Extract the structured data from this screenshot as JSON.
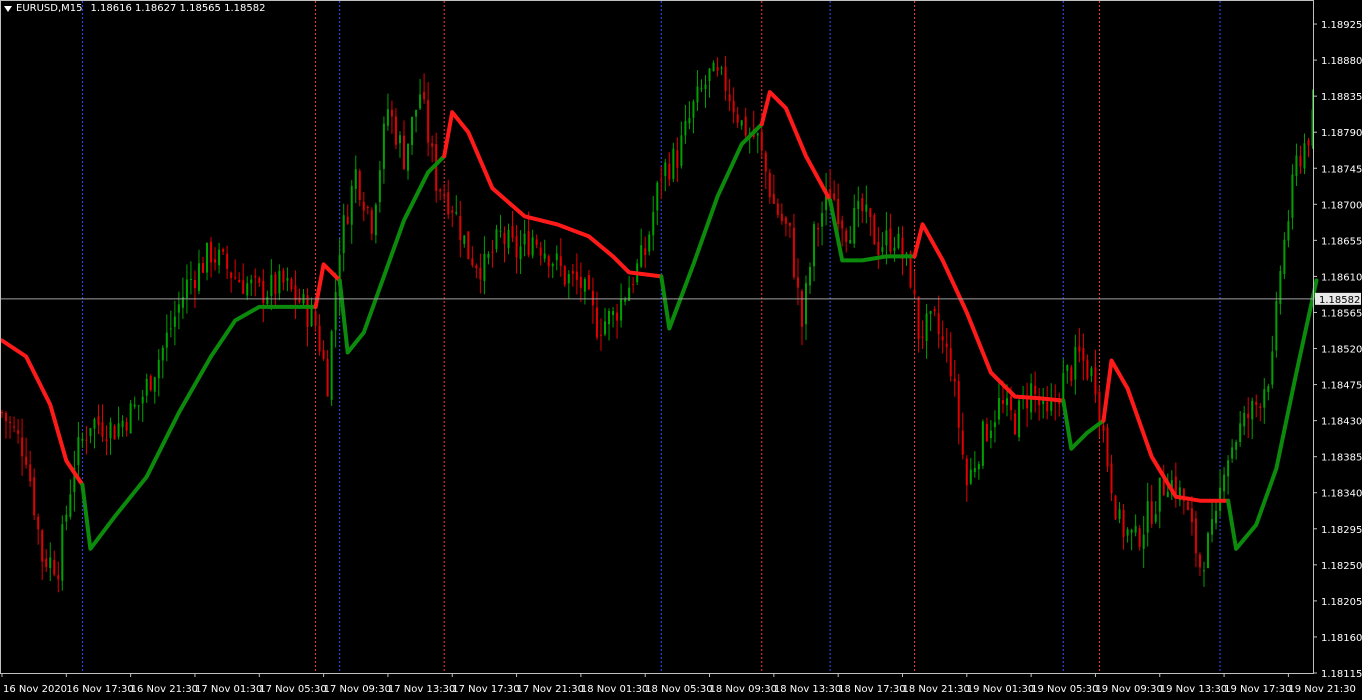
{
  "header": {
    "symbol": "EURUSD,M15",
    "ohlc": "1.18616 1.18627 1.18565 1.18582"
  },
  "colors": {
    "background": "#000000",
    "frame": "#c0c0c0",
    "candle_up": "#00a000",
    "candle_down": "#e00000",
    "line_up": "#0c8a0c",
    "line_down": "#ff1a1a",
    "separator_red": "#ff3030",
    "separator_blue": "#3050ff",
    "current_price_line": "#a0a0a0"
  },
  "chart_data": {
    "type": "candlestick",
    "y_ticks": [
      "1.18925",
      "1.18880",
      "1.18835",
      "1.18790",
      "1.18745",
      "1.18700",
      "1.18655",
      "1.18610",
      "1.18565",
      "1.18520",
      "1.18475",
      "1.18430",
      "1.18385",
      "1.18340",
      "1.18295",
      "1.18250",
      "1.18205",
      "1.18160",
      "1.18115"
    ],
    "ylim": [
      1.18115,
      1.18955
    ],
    "current_price": "1.18582",
    "x_labels": [
      "16 Nov 2020",
      "16 Nov 17:30",
      "16 Nov 21:30",
      "17 Nov 01:30",
      "17 Nov 05:30",
      "17 Nov 09:30",
      "17 Nov 13:30",
      "17 Nov 17:30",
      "17 Nov 21:30",
      "18 Nov 01:30",
      "18 Nov 05:30",
      "18 Nov 09:30",
      "18 Nov 13:30",
      "18 Nov 17:30",
      "18 Nov 21:30",
      "19 Nov 01:30",
      "19 Nov 05:30",
      "19 Nov 09:30",
      "19 Nov 13:30",
      "19 Nov 17:30",
      "19 Nov 21:30"
    ],
    "x_label_index": [
      0,
      16,
      32,
      48,
      64,
      80,
      96,
      112,
      128,
      144,
      160,
      176,
      192,
      208,
      224,
      240,
      256,
      272,
      288,
      304,
      320
    ],
    "bar_count": 327,
    "red_separators_index": [
      78,
      110,
      189,
      227,
      273
    ],
    "blue_separators_index": [
      20,
      84,
      164,
      206,
      264,
      303
    ],
    "close_path": [
      [
        0,
        1.1844
      ],
      [
        6,
        1.1839
      ],
      [
        10,
        1.1826
      ],
      [
        14,
        1.1825
      ],
      [
        18,
        1.1838
      ],
      [
        22,
        1.1843
      ],
      [
        28,
        1.1842
      ],
      [
        34,
        1.1845
      ],
      [
        40,
        1.1852
      ],
      [
        46,
        1.186
      ],
      [
        52,
        1.1864
      ],
      [
        58,
        1.1861
      ],
      [
        64,
        1.1859
      ],
      [
        70,
        1.186
      ],
      [
        74,
        1.1858
      ],
      [
        78,
        1.1855
      ],
      [
        81,
        1.1848
      ],
      [
        84,
        1.1865
      ],
      [
        88,
        1.1874
      ],
      [
        92,
        1.1868
      ],
      [
        96,
        1.1882
      ],
      [
        100,
        1.1876
      ],
      [
        104,
        1.1884
      ],
      [
        108,
        1.1873
      ],
      [
        112,
        1.187
      ],
      [
        116,
        1.1864
      ],
      [
        120,
        1.1862
      ],
      [
        124,
        1.1866
      ],
      [
        128,
        1.1864
      ],
      [
        132,
        1.1866
      ],
      [
        136,
        1.1864
      ],
      [
        140,
        1.1861
      ],
      [
        144,
        1.186
      ],
      [
        148,
        1.1855
      ],
      [
        152,
        1.1856
      ],
      [
        156,
        1.186
      ],
      [
        160,
        1.1864
      ],
      [
        164,
        1.1874
      ],
      [
        168,
        1.1876
      ],
      [
        172,
        1.1882
      ],
      [
        176,
        1.1886
      ],
      [
        180,
        1.1885
      ],
      [
        184,
        1.188
      ],
      [
        188,
        1.1878
      ],
      [
        192,
        1.187
      ],
      [
        196,
        1.1866
      ],
      [
        199,
        1.1855
      ],
      [
        202,
        1.1866
      ],
      [
        206,
        1.1872
      ],
      [
        210,
        1.1867
      ],
      [
        214,
        1.1869
      ],
      [
        218,
        1.1865
      ],
      [
        222,
        1.1866
      ],
      [
        226,
        1.1861
      ],
      [
        228,
        1.1854
      ],
      [
        232,
        1.1855
      ],
      [
        236,
        1.185
      ],
      [
        240,
        1.1835
      ],
      [
        244,
        1.1841
      ],
      [
        248,
        1.1845
      ],
      [
        252,
        1.1843
      ],
      [
        256,
        1.1847
      ],
      [
        260,
        1.1843
      ],
      [
        264,
        1.1848
      ],
      [
        268,
        1.1851
      ],
      [
        272,
        1.1848
      ],
      [
        275,
        1.1838
      ],
      [
        278,
        1.183
      ],
      [
        282,
        1.1828
      ],
      [
        286,
        1.1832
      ],
      [
        290,
        1.1836
      ],
      [
        294,
        1.1833
      ],
      [
        298,
        1.1825
      ],
      [
        302,
        1.183
      ],
      [
        304,
        1.1838
      ],
      [
        308,
        1.1842
      ],
      [
        312,
        1.1845
      ],
      [
        316,
        1.185
      ],
      [
        318,
        1.1862
      ],
      [
        322,
        1.1875
      ],
      [
        326,
        1.188
      ]
    ],
    "indicator_segments": [
      {
        "trend": "down",
        "points": [
          [
            0,
            1.1853
          ],
          [
            6,
            1.1851
          ],
          [
            12,
            1.1845
          ],
          [
            16,
            1.1838
          ],
          [
            20,
            1.1835
          ]
        ]
      },
      {
        "trend": "up",
        "points": [
          [
            20,
            1.1835
          ],
          [
            22,
            1.1827
          ],
          [
            28,
            1.1831
          ],
          [
            36,
            1.1836
          ],
          [
            44,
            1.1844
          ],
          [
            52,
            1.1851
          ],
          [
            58,
            1.18555
          ],
          [
            64,
            1.18572
          ],
          [
            70,
            1.18572
          ],
          [
            78,
            1.18572
          ]
        ]
      },
      {
        "trend": "down",
        "points": [
          [
            78,
            1.18572
          ],
          [
            80,
            1.18625
          ],
          [
            84,
            1.18605
          ]
        ]
      },
      {
        "trend": "up",
        "points": [
          [
            84,
            1.18605
          ],
          [
            86,
            1.18515
          ],
          [
            90,
            1.1854
          ],
          [
            95,
            1.1861
          ],
          [
            100,
            1.1868
          ],
          [
            106,
            1.1874
          ],
          [
            110,
            1.1876
          ]
        ]
      },
      {
        "trend": "down",
        "points": [
          [
            110,
            1.1876
          ],
          [
            112,
            1.18815
          ],
          [
            116,
            1.1879
          ],
          [
            122,
            1.1872
          ],
          [
            130,
            1.18685
          ],
          [
            138,
            1.18675
          ],
          [
            146,
            1.1866
          ],
          [
            152,
            1.18635
          ],
          [
            156,
            1.18615
          ],
          [
            164,
            1.1861
          ]
        ]
      },
      {
        "trend": "up",
        "points": [
          [
            164,
            1.1861
          ],
          [
            166,
            1.18545
          ],
          [
            172,
            1.18625
          ],
          [
            178,
            1.1871
          ],
          [
            184,
            1.18775
          ],
          [
            189,
            1.188
          ]
        ]
      },
      {
        "trend": "down",
        "points": [
          [
            189,
            1.188
          ],
          [
            191,
            1.1884
          ],
          [
            195,
            1.1882
          ],
          [
            200,
            1.1876
          ],
          [
            206,
            1.18705
          ]
        ]
      },
      {
        "trend": "up",
        "points": [
          [
            206,
            1.18705
          ],
          [
            209,
            1.1863
          ],
          [
            214,
            1.1863
          ],
          [
            220,
            1.18635
          ],
          [
            227,
            1.18635
          ]
        ]
      },
      {
        "trend": "down",
        "points": [
          [
            227,
            1.18635
          ],
          [
            229,
            1.18675
          ],
          [
            234,
            1.1863
          ],
          [
            240,
            1.18565
          ],
          [
            246,
            1.1849
          ],
          [
            252,
            1.1846
          ],
          [
            258,
            1.18458
          ],
          [
            264,
            1.18455
          ]
        ]
      },
      {
        "trend": "up",
        "points": [
          [
            264,
            1.18455
          ],
          [
            266,
            1.18395
          ],
          [
            270,
            1.18415
          ],
          [
            274,
            1.1843
          ]
        ]
      },
      {
        "trend": "down",
        "points": [
          [
            274,
            1.1843
          ],
          [
            276,
            1.18505
          ],
          [
            280,
            1.1847
          ],
          [
            286,
            1.18385
          ],
          [
            292,
            1.18335
          ],
          [
            298,
            1.1833
          ],
          [
            305,
            1.1833
          ]
        ]
      },
      {
        "trend": "up",
        "points": [
          [
            305,
            1.1833
          ],
          [
            307,
            1.1827
          ],
          [
            312,
            1.183
          ],
          [
            317,
            1.1837
          ],
          [
            322,
            1.1849
          ],
          [
            327,
            1.18605
          ]
        ]
      }
    ]
  }
}
